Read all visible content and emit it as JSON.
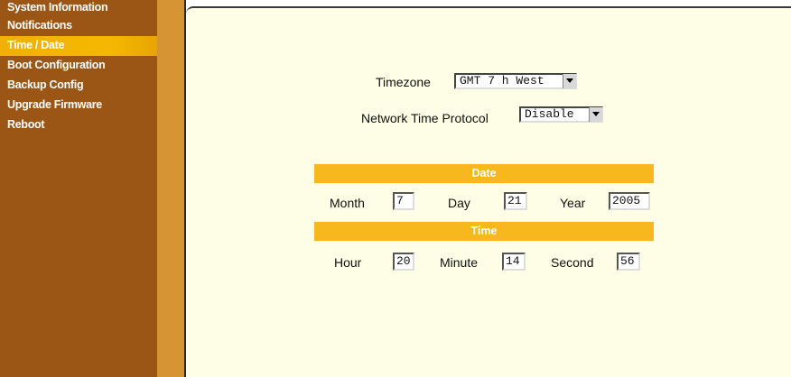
{
  "sidebar": {
    "items": [
      {
        "label": "System Information",
        "active": false
      },
      {
        "label": "Notifications",
        "active": false
      },
      {
        "label": "Time / Date",
        "active": true
      },
      {
        "label": "Boot Configuration",
        "active": false
      },
      {
        "label": "Backup Config",
        "active": false
      },
      {
        "label": "Upgrade Firmware",
        "active": false
      },
      {
        "label": "Reboot",
        "active": false
      }
    ]
  },
  "settings": {
    "timezone_label": "Timezone",
    "timezone_value": "GMT 7 h West",
    "ntp_label": "Network Time Protocol",
    "ntp_value": "Disable"
  },
  "date_section": {
    "title": "Date",
    "month_label": "Month",
    "month_value": "7",
    "day_label": "Day",
    "day_value": "21",
    "year_label": "Year",
    "year_value": "2005"
  },
  "time_section": {
    "title": "Time",
    "hour_label": "Hour",
    "hour_value": "20",
    "minute_label": "Minute",
    "minute_value": "14",
    "second_label": "Second",
    "second_value": "56"
  },
  "colors": {
    "sidebar_bg": "#9b5616",
    "active_item": "#f0b400",
    "divider": "#d69433",
    "content_bg": "#fefee6",
    "section_bar": "#f6b81c"
  }
}
